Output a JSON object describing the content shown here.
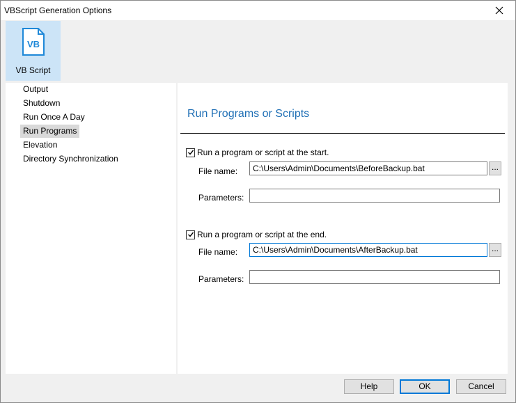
{
  "window": {
    "title": "VBScript Generation Options",
    "close_glyph": "✕"
  },
  "ribbon": {
    "tile_label": "VB Script",
    "tile_icon": "vb-script-icon",
    "icon_text": "VB"
  },
  "nav": {
    "items": [
      {
        "label": "Output",
        "selected": false
      },
      {
        "label": "Shutdown",
        "selected": false
      },
      {
        "label": "Run Once A Day",
        "selected": false
      },
      {
        "label": "Run Programs",
        "selected": true
      },
      {
        "label": "Elevation",
        "selected": false
      },
      {
        "label": "Directory Synchronization",
        "selected": false
      }
    ]
  },
  "main": {
    "title": "Run Programs or Scripts",
    "start": {
      "checkbox_label": "Run a program or script at the start.",
      "checked": true,
      "file_label": "File name:",
      "file_value": "C:\\Users\\Admin\\Documents\\BeforeBackup.bat",
      "params_label": "Parameters:",
      "params_value": "",
      "browse_label": "..."
    },
    "end": {
      "checkbox_label": "Run a program or script at the end.",
      "checked": true,
      "file_label": "File name:",
      "file_value": "C:\\Users\\Admin\\Documents\\AfterBackup.bat",
      "params_label": "Parameters:",
      "params_value": "",
      "browse_label": "..."
    }
  },
  "buttons": {
    "help": "Help",
    "ok": "OK",
    "cancel": "Cancel"
  },
  "colors": {
    "accent": "#0078d7",
    "title_blue": "#1f6fb5",
    "tile_bg": "#cce4f7",
    "selected_bg": "#d9d9d9"
  }
}
